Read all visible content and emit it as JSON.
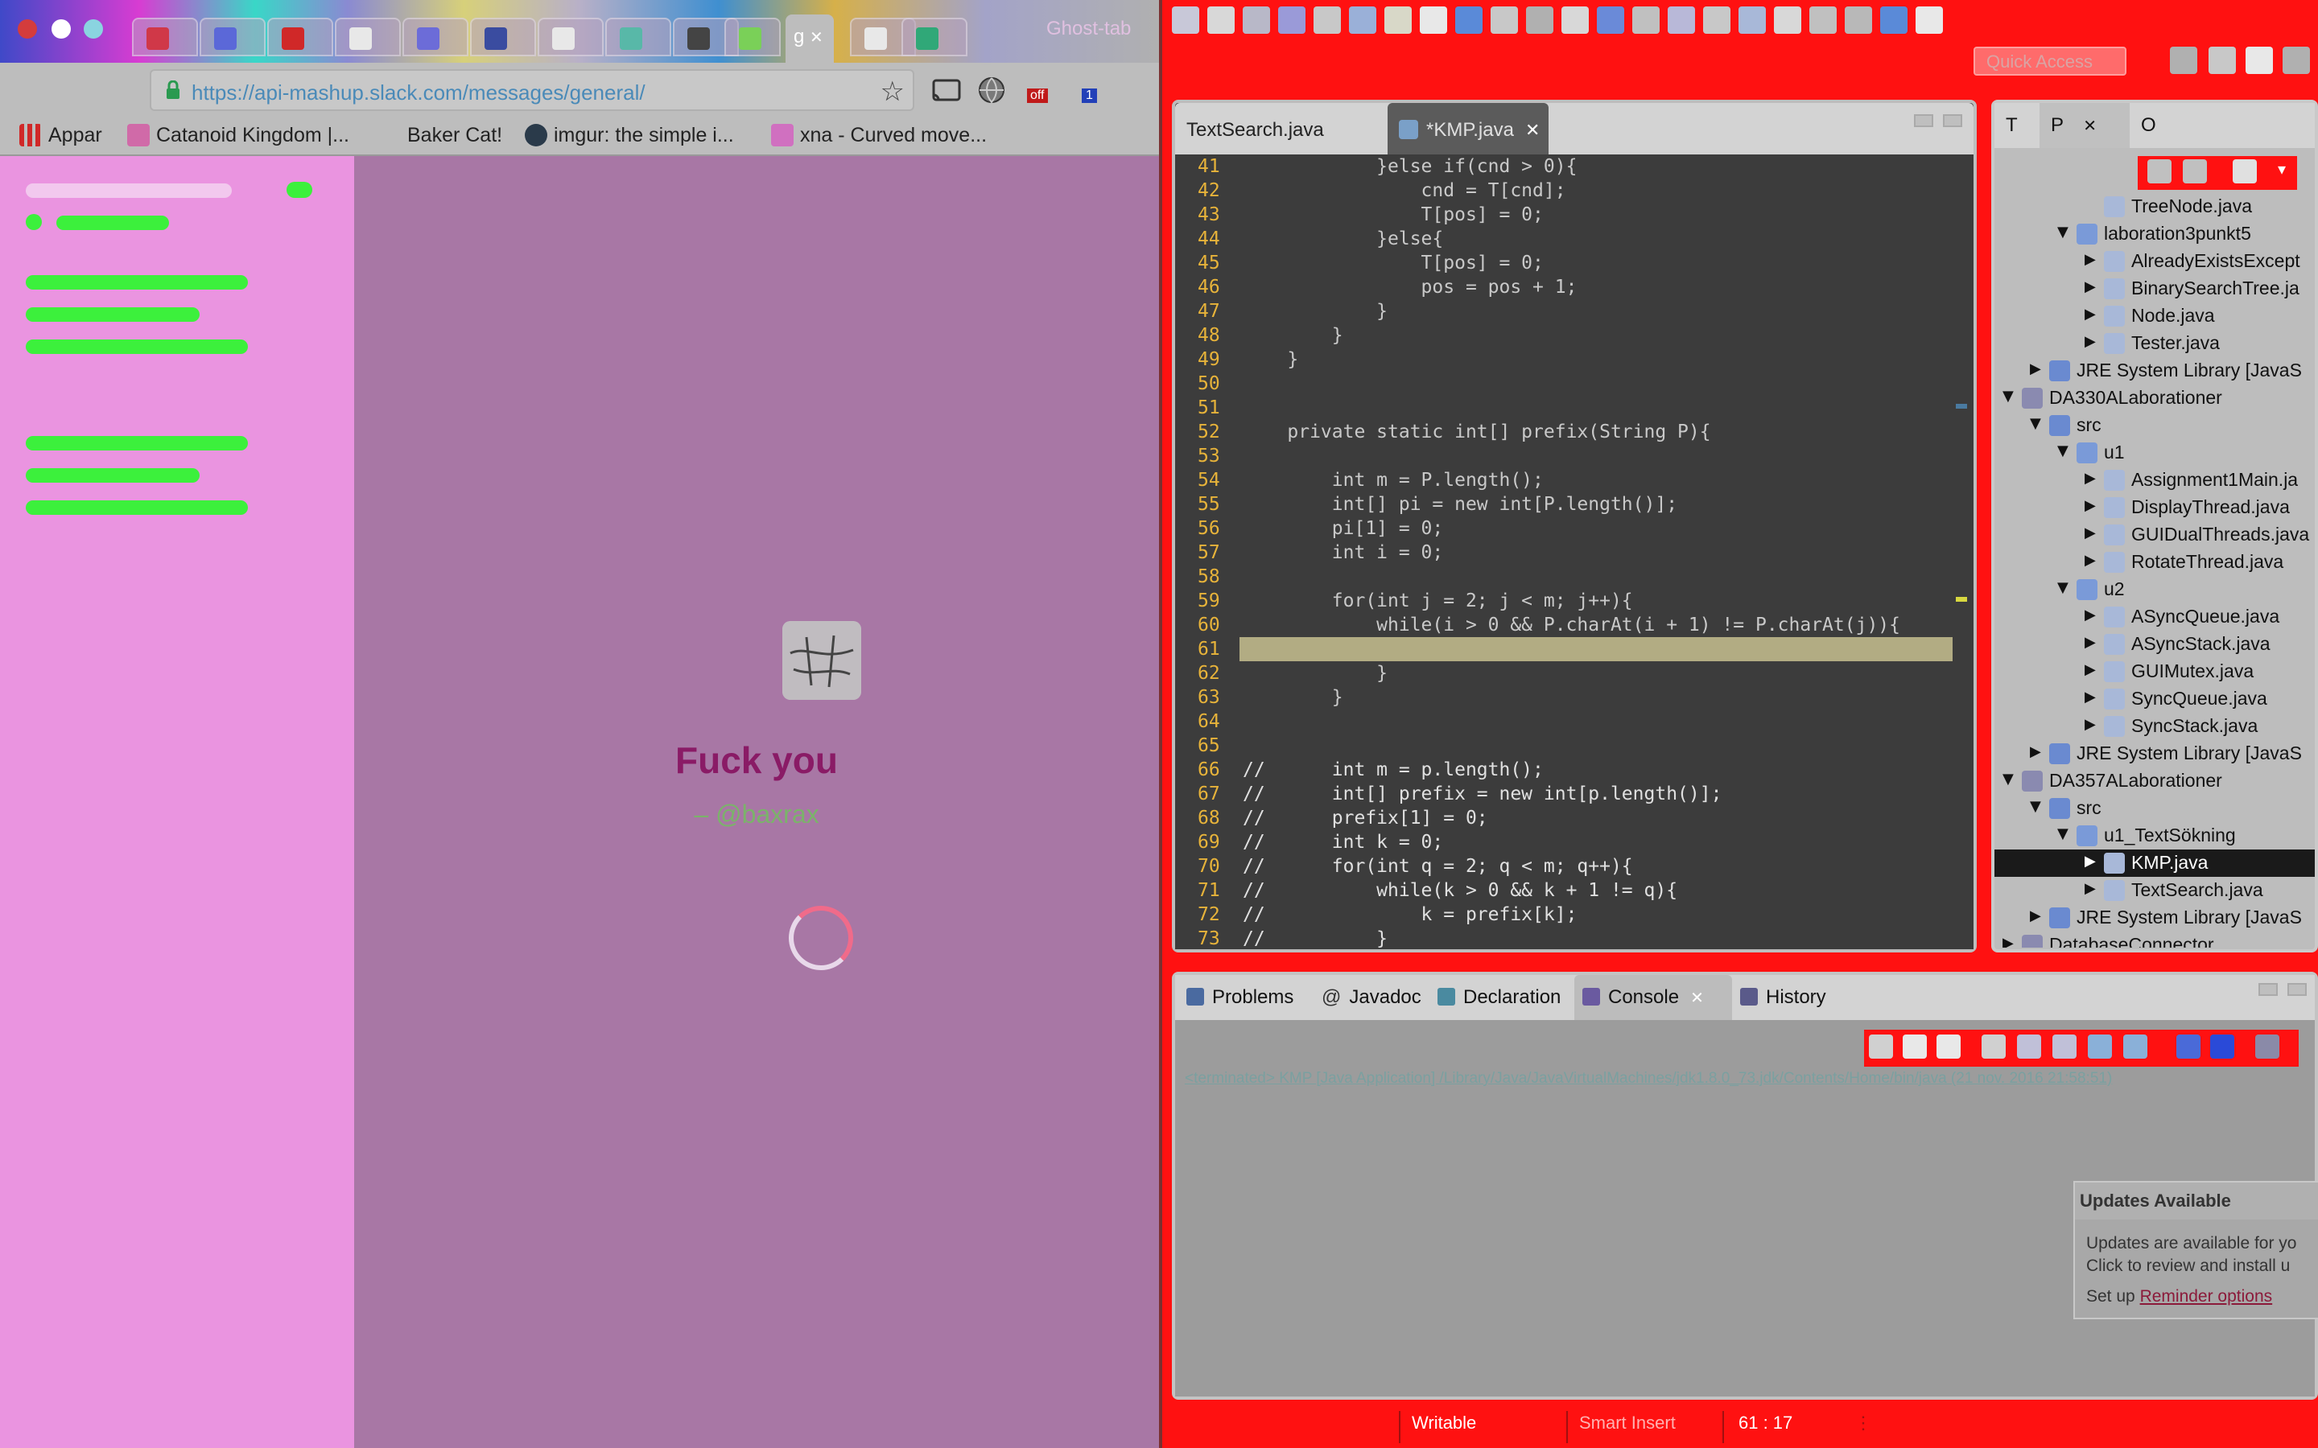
{
  "browser": {
    "url": "https://api-mashup.slack.com/messages/general/",
    "active_tab_label": "g",
    "new_tab_label": "Ghost-tab",
    "bookmarks": [
      {
        "label": "Appar"
      },
      {
        "label": "Catanoid Kingdom |..."
      },
      {
        "label": "Baker Cat!"
      },
      {
        "label": "imgur: the simple i..."
      },
      {
        "label": "xna - Curved move..."
      }
    ],
    "cast_badge": "off",
    "ext_badge": "1"
  },
  "slack": {
    "loading_text": "Fuck you",
    "loading_sub": "– @baxrax"
  },
  "eclipse": {
    "quick_access_placeholder": "Quick Access",
    "editor_tabs": [
      {
        "label": "TextSearch.java"
      },
      {
        "label": "*KMP.java"
      }
    ],
    "code_lines": [
      {
        "n": "41",
        "text": "            }else if(cnd > 0){"
      },
      {
        "n": "42",
        "text": "                cnd = T[cnd];"
      },
      {
        "n": "43",
        "text": "                T[pos] = 0;"
      },
      {
        "n": "44",
        "text": "            }else{"
      },
      {
        "n": "45",
        "text": "                T[pos] = 0;"
      },
      {
        "n": "46",
        "text": "                pos = pos + 1;"
      },
      {
        "n": "47",
        "text": "            }"
      },
      {
        "n": "48",
        "text": "        }"
      },
      {
        "n": "49",
        "text": "    }"
      },
      {
        "n": "50",
        "text": ""
      },
      {
        "n": "51",
        "text": ""
      },
      {
        "n": "52",
        "text": "    private static int[] prefix(String P){"
      },
      {
        "n": "53",
        "text": ""
      },
      {
        "n": "54",
        "text": "        int m = P.length();"
      },
      {
        "n": "55",
        "text": "        int[] pi = new int[P.length()];"
      },
      {
        "n": "56",
        "text": "        pi[1] = 0;"
      },
      {
        "n": "57",
        "text": "        int i = 0;"
      },
      {
        "n": "58",
        "text": ""
      },
      {
        "n": "59",
        "text": "        for(int j = 2; j < m; j++){"
      },
      {
        "n": "60",
        "text": "            while(i > 0 && P.charAt(i + 1) != P.charAt(j)){"
      },
      {
        "n": "61",
        "text": ""
      },
      {
        "n": "62",
        "text": "            }"
      },
      {
        "n": "63",
        "text": "        }"
      },
      {
        "n": "64",
        "text": ""
      },
      {
        "n": "65",
        "text": ""
      },
      {
        "n": "66",
        "text": "//      int m = p.length();"
      },
      {
        "n": "67",
        "text": "//      int[] prefix = new int[p.length()];"
      },
      {
        "n": "68",
        "text": "//      prefix[1] = 0;"
      },
      {
        "n": "69",
        "text": "//      int k = 0;"
      },
      {
        "n": "70",
        "text": "//      for(int q = 2; q < m; q++){"
      },
      {
        "n": "71",
        "text": "//          while(k > 0 && k + 1 != q){"
      },
      {
        "n": "72",
        "text": "//              k = prefix[k];"
      },
      {
        "n": "73",
        "text": "//          }"
      }
    ],
    "explorer_tabs": [
      {
        "label": "T"
      },
      {
        "label": "P"
      },
      {
        "label": "O"
      }
    ],
    "tree": [
      {
        "label": "TreeNode.java",
        "depth": 3,
        "exp": "leaf",
        "sel": false
      },
      {
        "label": "laboration3punkt5",
        "depth": 2,
        "exp": "open",
        "sel": false
      },
      {
        "label": "AlreadyExistsExcept",
        "depth": 3,
        "exp": "closed",
        "sel": false
      },
      {
        "label": "BinarySearchTree.ja",
        "depth": 3,
        "exp": "closed",
        "sel": false
      },
      {
        "label": "Node.java",
        "depth": 3,
        "exp": "closed",
        "sel": false
      },
      {
        "label": "Tester.java",
        "depth": 3,
        "exp": "closed",
        "sel": false
      },
      {
        "label": "JRE System Library [JavaS",
        "depth": 1,
        "exp": "closed",
        "sel": false
      },
      {
        "label": "DA330ALaborationer",
        "depth": 0,
        "exp": "open",
        "sel": false
      },
      {
        "label": "src",
        "depth": 1,
        "exp": "open",
        "sel": false
      },
      {
        "label": "u1",
        "depth": 2,
        "exp": "open",
        "sel": false
      },
      {
        "label": "Assignment1Main.ja",
        "depth": 3,
        "exp": "closed",
        "sel": false
      },
      {
        "label": "DisplayThread.java",
        "depth": 3,
        "exp": "closed",
        "sel": false
      },
      {
        "label": "GUIDualThreads.java",
        "depth": 3,
        "exp": "closed",
        "sel": false
      },
      {
        "label": "RotateThread.java",
        "depth": 3,
        "exp": "closed",
        "sel": false
      },
      {
        "label": "u2",
        "depth": 2,
        "exp": "open",
        "sel": false
      },
      {
        "label": "ASyncQueue.java",
        "depth": 3,
        "exp": "closed",
        "sel": false
      },
      {
        "label": "ASyncStack.java",
        "depth": 3,
        "exp": "closed",
        "sel": false
      },
      {
        "label": "GUIMutex.java",
        "depth": 3,
        "exp": "closed",
        "sel": false
      },
      {
        "label": "SyncQueue.java",
        "depth": 3,
        "exp": "closed",
        "sel": false
      },
      {
        "label": "SyncStack.java",
        "depth": 3,
        "exp": "closed",
        "sel": false
      },
      {
        "label": "JRE System Library [JavaS",
        "depth": 1,
        "exp": "closed",
        "sel": false
      },
      {
        "label": "DA357ALaborationer",
        "depth": 0,
        "exp": "open",
        "sel": false
      },
      {
        "label": "src",
        "depth": 1,
        "exp": "open",
        "sel": false
      },
      {
        "label": "u1_TextSökning",
        "depth": 2,
        "exp": "open",
        "sel": false
      },
      {
        "label": "KMP.java",
        "depth": 3,
        "exp": "closed",
        "sel": true
      },
      {
        "label": "TextSearch.java",
        "depth": 3,
        "exp": "closed",
        "sel": false
      },
      {
        "label": "JRE System Library [JavaS",
        "depth": 1,
        "exp": "closed",
        "sel": false
      },
      {
        "label": "DatabaseConnector",
        "depth": 0,
        "exp": "closed",
        "sel": false
      }
    ],
    "console_tabs": [
      {
        "label": "Problems"
      },
      {
        "label": "Javadoc"
      },
      {
        "label": "Declaration"
      },
      {
        "label": "Console"
      },
      {
        "label": "History"
      }
    ],
    "console_status": "<terminated> KMP [Java Application] /Library/Java/JavaVirtualMachines/jdk1.8.0_73.jdk/Contents/Home/bin/java (21 nov. 2016 21:58:51)",
    "updates": {
      "title": "Updates Available",
      "line1": "Updates are available for yo",
      "line2": "Click to review and install u",
      "line3_prefix": "Set up",
      "line3_link": "Reminder options"
    },
    "status": {
      "writable": "Writable",
      "insert_mode": "Smart Insert",
      "position": "61 : 17"
    }
  },
  "colors": {
    "eclipse_bg": "#ff1111",
    "slack_sidebar": "#ea94e0",
    "slack_main": "#a877a5",
    "skeleton_green": "#3cf03c",
    "loader_text": "#8a1b66"
  }
}
